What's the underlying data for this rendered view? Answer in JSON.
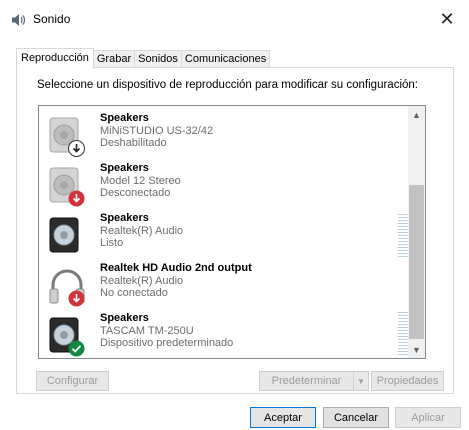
{
  "window": {
    "title": "Sonido",
    "icon": "speaker-icon"
  },
  "tabs": [
    {
      "label": "Reproducción",
      "active": true
    },
    {
      "label": "Grabar",
      "active": false
    },
    {
      "label": "Sonidos",
      "active": false
    },
    {
      "label": "Comunicaciones",
      "active": false
    }
  ],
  "instruction": "Seleccione un dispositivo de reproducción para modificar su configuración:",
  "devices": [
    {
      "name": "Speakers",
      "description": "MiNiSTUDIO US-32/42",
      "status": "Deshabilitado",
      "icon": "speaker-icon",
      "badge": "disabled-arrow-icon"
    },
    {
      "name": "Speakers",
      "description": "Model 12 Stereo",
      "status": "Desconectado",
      "icon": "speaker-icon",
      "badge": "disconnected-arrow-icon"
    },
    {
      "name": "Speakers",
      "description": "Realtek(R) Audio",
      "status": "Listo",
      "icon": "speaker-icon",
      "badge": "none",
      "level_meter": true
    },
    {
      "name": "Realtek HD Audio 2nd output",
      "description": "Realtek(R) Audio",
      "status": "No conectado",
      "icon": "headphones-icon",
      "badge": "disconnected-arrow-icon"
    },
    {
      "name": "Speakers",
      "description": "TASCAM TM-250U",
      "status": "Dispositivo predeterminado",
      "icon": "speaker-icon",
      "badge": "default-check-icon",
      "level_meter": true
    }
  ],
  "buttons": {
    "configure": "Configurar",
    "set_default": "Predeterminar",
    "properties": "Propiedades",
    "ok": "Aceptar",
    "cancel": "Cancelar",
    "apply": "Aplicar"
  },
  "colors": {
    "accent": "#0078d7",
    "disconnected_red": "#d13438",
    "default_green": "#10893e",
    "meter": "#b9d2db"
  }
}
